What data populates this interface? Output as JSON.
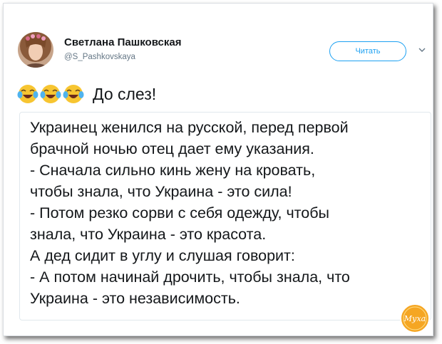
{
  "tweet": {
    "author_name": "Светлана Пашковская",
    "author_handle": "@S_Pashkovskaya",
    "follow_label": "Читать",
    "text": "До слез!",
    "emojis": [
      "joy-emoji",
      "joy-emoji",
      "joy-emoji"
    ],
    "quote_lines": [
      "Украинец женился на русской, перед первой",
      "брачной ночью отец дает ему указания.",
      "- Сначала сильно кинь жену на кровать,",
      "чтобы знала, что Украина - это сила!",
      "- Потом резко сорви с себя одежду, чтобы",
      "знала, что Украина - это красота.",
      "А дед сидит в углу и слушая говорит:",
      "- А потом начинай дрочить, чтобы знала, что",
      "Украина - это независимость."
    ]
  },
  "watermark": {
    "text": "Муха"
  },
  "colors": {
    "accent": "#1da1f2",
    "text": "#14171a",
    "muted": "#657786",
    "border": "#e1e8ed"
  }
}
